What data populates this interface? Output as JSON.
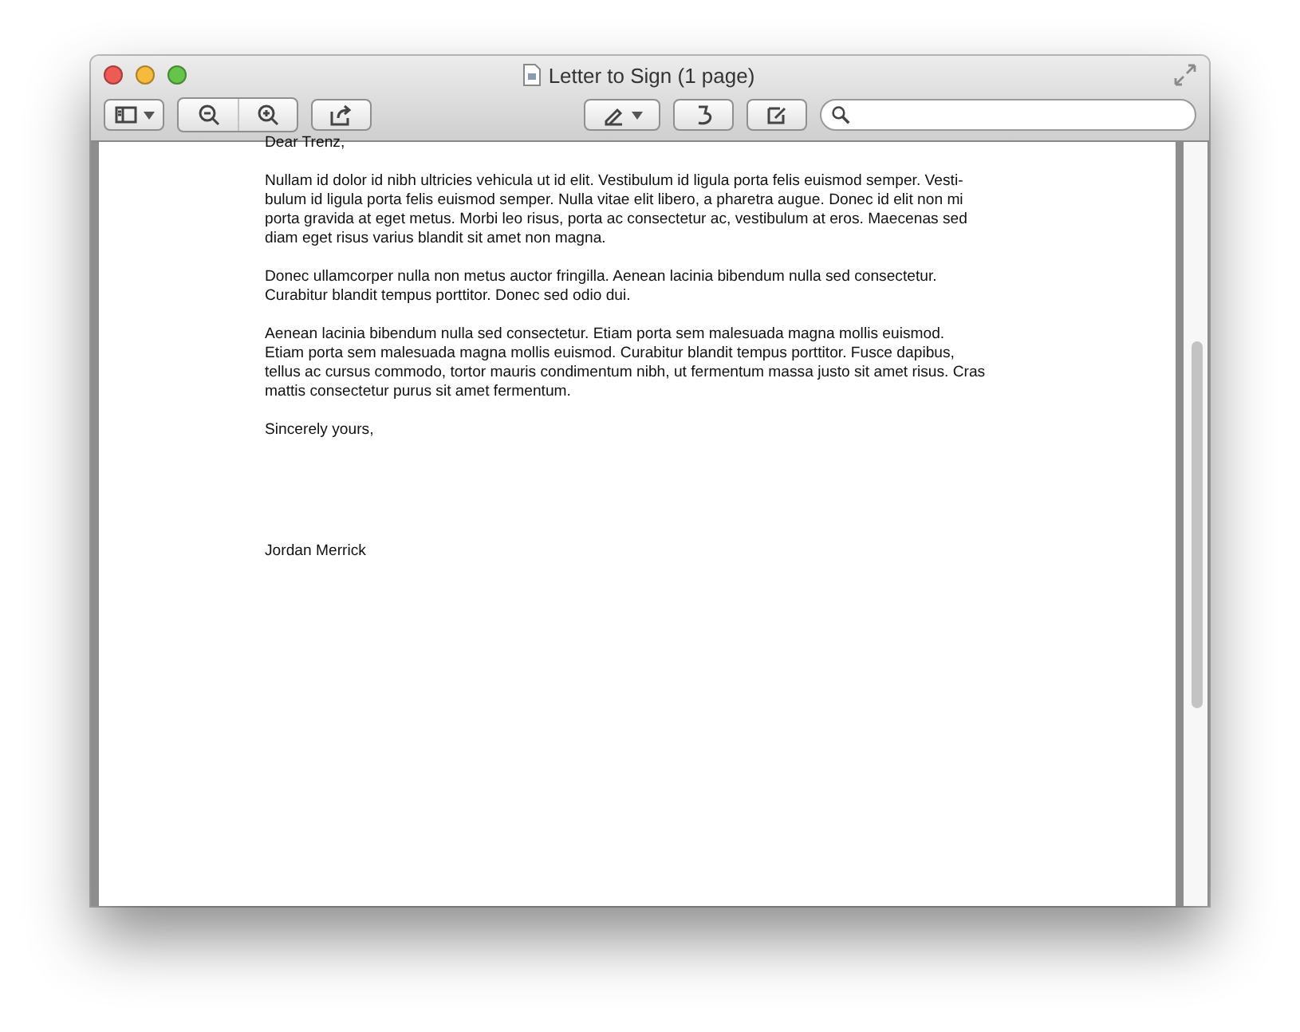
{
  "window": {
    "title": "Letter to Sign (1 page)"
  },
  "document": {
    "greeting": "Dear Trenz,",
    "paragraphs": [
      {
        "lines": [
          "Nullam id dolor id nibh ultricies vehicula ut id elit. Vestibulum id ligula porta felis euismod semper. Vesti-",
          "bulum id ligula porta felis euismod semper. Nulla vitae elit libero, a pharetra augue. Donec id elit non mi",
          "porta gravida at eget metus. Morbi leo risus, porta ac consectetur ac, vestibulum at eros. Maecenas sed",
          "diam eget risus varius blandit sit amet non magna."
        ]
      },
      {
        "lines": [
          "Donec ullamcorper nulla non metus auctor fringilla. Aenean lacinia bibendum nulla sed consectetur.",
          "Curabitur blandit tempus porttitor. Donec sed odio dui."
        ]
      },
      {
        "lines": [
          "Aenean lacinia bibendum nulla sed consectetur. Etiam porta sem malesuada magna mollis euismod.",
          "Etiam porta sem malesuada magna mollis euismod. Curabitur blandit tempus porttitor. Fusce dapibus,",
          "tellus ac cursus commodo, tortor mauris condimentum nibh, ut fermentum massa justo sit amet risus. Cras",
          "mattis consectetur purus sit amet fermentum."
        ]
      }
    ],
    "closing": "Sincerely yours,",
    "signature": "Jordan Merrick"
  }
}
